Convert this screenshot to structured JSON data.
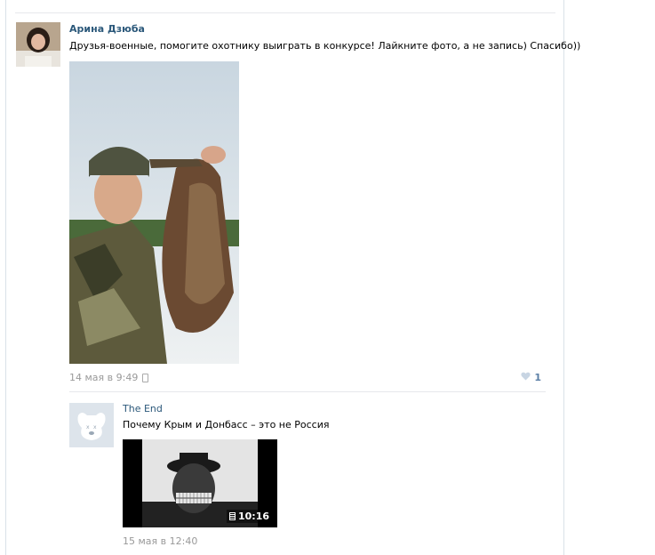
{
  "post": {
    "author": "Арина Дзюба",
    "text": "Друзья-военные, помогите охотнику выиграть в конкурсе! Лайкните фото, а не запись) Спасибо))",
    "timestamp": "14 мая в 9:49",
    "likes": "1",
    "icons": {
      "device": "phone-icon",
      "like": "heart-icon"
    }
  },
  "reply": {
    "author": "The End",
    "text": "Почему Крым и Донбасс – это не Россия",
    "video_duration": "10:16",
    "timestamp": "15 мая в 12:40",
    "icons": {
      "avatar": "vk-dog-avatar-icon",
      "video": "film-icon"
    }
  },
  "colors": {
    "link": "#2b587a",
    "meta": "#999999",
    "like": "#5b7fa6"
  }
}
